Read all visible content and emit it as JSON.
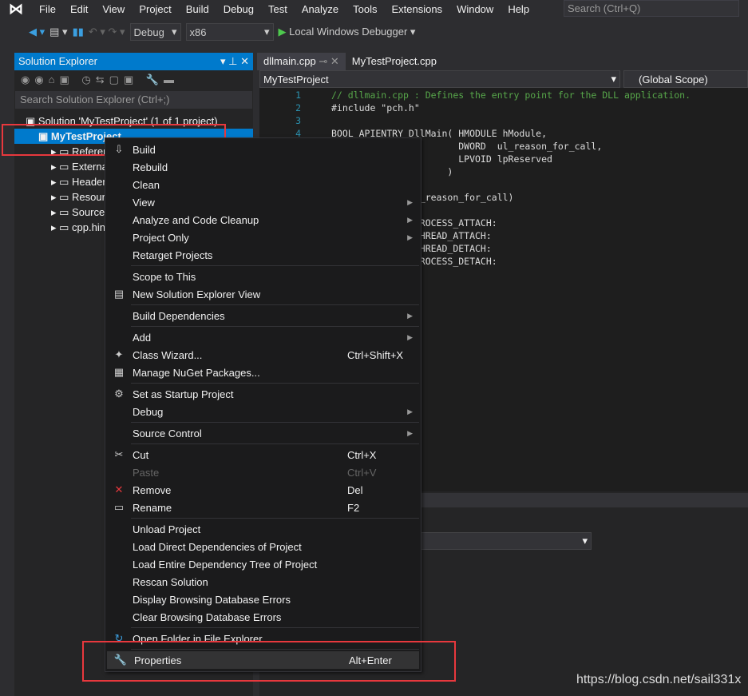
{
  "menubar": {
    "items": [
      "File",
      "Edit",
      "View",
      "Project",
      "Build",
      "Debug",
      "Test",
      "Analyze",
      "Tools",
      "Extensions",
      "Window",
      "Help"
    ],
    "search_placeholder": "Search (Ctrl+Q)"
  },
  "toolbar": {
    "config": "Debug",
    "platform": "x86",
    "run": "Local Windows Debugger"
  },
  "solution_explorer": {
    "title": "Solution Explorer",
    "search_placeholder": "Search Solution Explorer (Ctrl+;)",
    "tree": [
      {
        "label": "Solution 'MyTestProject' (1 of 1 project)",
        "indent": 0
      },
      {
        "label": "MyTestProject",
        "indent": 1,
        "selected": true
      },
      {
        "label": "References",
        "indent": 2
      },
      {
        "label": "External Dependencies",
        "indent": 2
      },
      {
        "label": "Header Files",
        "indent": 2
      },
      {
        "label": "Resource Files",
        "indent": 2
      },
      {
        "label": "Source Files",
        "indent": 2
      },
      {
        "label": "cpp.hint",
        "indent": 2
      }
    ]
  },
  "editor": {
    "tabs": [
      "dllmain.cpp",
      "MyTestProject.cpp"
    ],
    "project_scope": "MyTestProject",
    "scope": "(Global Scope)",
    "lines": [
      {
        "n": "1",
        "t": "// dllmain.cpp : Defines the entry point for the DLL application."
      },
      {
        "n": "2",
        "t": "#include \"pch.h\""
      },
      {
        "n": "3",
        "t": ""
      },
      {
        "n": "4",
        "t": "BOOL APIENTRY DllMain( HMODULE hModule,"
      },
      {
        "n": "",
        "t": "                       DWORD  ul_reason_for_call,"
      },
      {
        "n": "",
        "t": "                       LPVOID lpReserved"
      },
      {
        "n": "",
        "t": "                     )"
      },
      {
        "n": "",
        "t": ""
      },
      {
        "n": "",
        "t": "      switch (ul_reason_for_call)"
      },
      {
        "n": "",
        "t": ""
      },
      {
        "n": "",
        "t": "      case DLL_PROCESS_ATTACH:"
      },
      {
        "n": "",
        "t": "      case DLL_THREAD_ATTACH:"
      },
      {
        "n": "",
        "t": "      case DLL_THREAD_DETACH:"
      },
      {
        "n": "",
        "t": "      case DLL_PROCESS_DETACH:"
      }
    ]
  },
  "context_menu": [
    [
      {
        "label": "Build",
        "icon": "build-icon"
      },
      {
        "label": "Rebuild"
      },
      {
        "label": "Clean"
      },
      {
        "label": "View",
        "sub": true
      },
      {
        "label": "Analyze and Code Cleanup",
        "sub": true
      },
      {
        "label": "Project Only",
        "sub": true
      },
      {
        "label": "Retarget Projects"
      }
    ],
    [
      {
        "label": "Scope to This"
      },
      {
        "label": "New Solution Explorer View",
        "icon": "new-view-icon"
      }
    ],
    [
      {
        "label": "Build Dependencies",
        "sub": true
      }
    ],
    [
      {
        "label": "Add",
        "sub": true
      },
      {
        "label": "Class Wizard...",
        "icon": "class-wizard-icon",
        "shortcut": "Ctrl+Shift+X"
      },
      {
        "label": "Manage NuGet Packages...",
        "icon": "nuget-icon"
      }
    ],
    [
      {
        "label": "Set as Startup Project",
        "icon": "gear-icon"
      },
      {
        "label": "Debug",
        "sub": true
      }
    ],
    [
      {
        "label": "Source Control",
        "sub": true
      }
    ],
    [
      {
        "label": "Cut",
        "icon": "scissors-icon",
        "shortcut": "Ctrl+X"
      },
      {
        "label": "Paste",
        "shortcut": "Ctrl+V",
        "disabled": true
      },
      {
        "label": "Remove",
        "icon": "remove-icon",
        "shortcut": "Del"
      },
      {
        "label": "Rename",
        "icon": "rename-icon",
        "shortcut": "F2"
      }
    ],
    [
      {
        "label": "Unload Project"
      },
      {
        "label": "Load Direct Dependencies of Project"
      },
      {
        "label": "Load Entire Dependency Tree of Project"
      },
      {
        "label": "Rescan Solution"
      },
      {
        "label": "Display Browsing Database Errors"
      },
      {
        "label": "Clear Browsing Database Errors"
      }
    ],
    [
      {
        "label": "Open Folder in File Explorer",
        "icon": "refresh-folder-icon"
      }
    ],
    [
      {
        "label": "Properties",
        "icon": "wrench-icon",
        "shortcut": "Alt+Enter",
        "highlighted": true
      }
    ]
  ],
  "watermark": "https://blog.csdn.net/sail331x",
  "colors": {
    "accent": "#007acc",
    "highlight_box": "#e8383d"
  }
}
